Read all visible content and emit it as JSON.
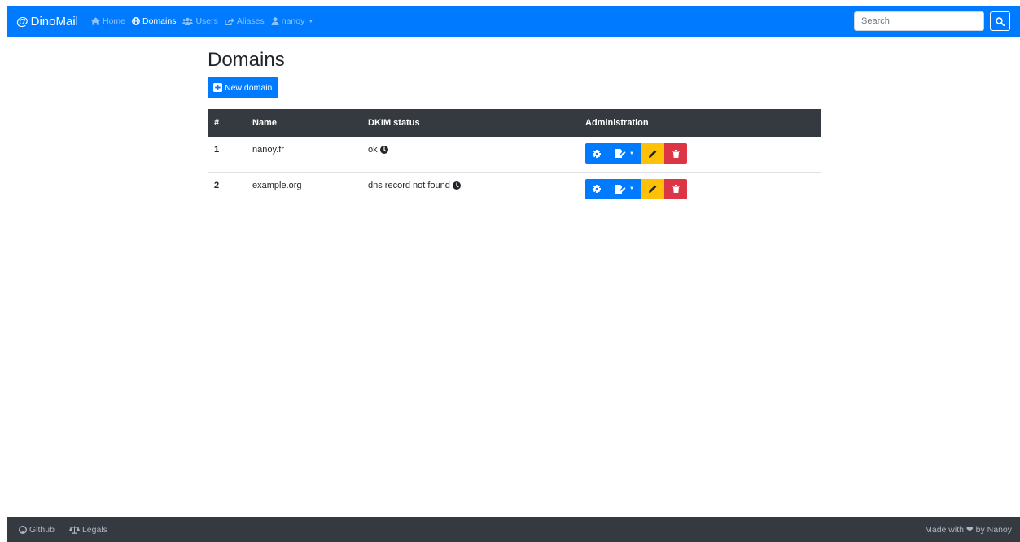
{
  "nav": {
    "brand_symbol": "@",
    "brand": "DinoMail",
    "items": [
      {
        "label": "Home",
        "icon": "home-icon",
        "active": false
      },
      {
        "label": "Domains",
        "icon": "globe-icon",
        "active": true
      },
      {
        "label": "Users",
        "icon": "users-icon",
        "active": false
      },
      {
        "label": "Aliases",
        "icon": "share-icon",
        "active": false
      },
      {
        "label": "nanoy",
        "icon": "user-icon",
        "active": false
      }
    ],
    "dropdown_caret": "▼",
    "search_placeholder": "Search"
  },
  "page": {
    "title": "Domains",
    "new_button": "New domain"
  },
  "table": {
    "headers": [
      "#",
      "Name",
      "DKIM status",
      "Administration"
    ],
    "rows": [
      {
        "id": "1",
        "name": "nanoy.fr",
        "dkim": "ok"
      },
      {
        "id": "2",
        "name": "example.org",
        "dkim": "dns record not found"
      }
    ],
    "dropdown_caret": "▼"
  },
  "footer": {
    "github": "Github",
    "legals": "Legals",
    "made_with": "Made with",
    "heart": "❤",
    "by": "by Nanoy"
  },
  "colors": {
    "primary": "#007bff",
    "dark": "#343a40",
    "warning": "#ffc107",
    "danger": "#dc3545"
  }
}
